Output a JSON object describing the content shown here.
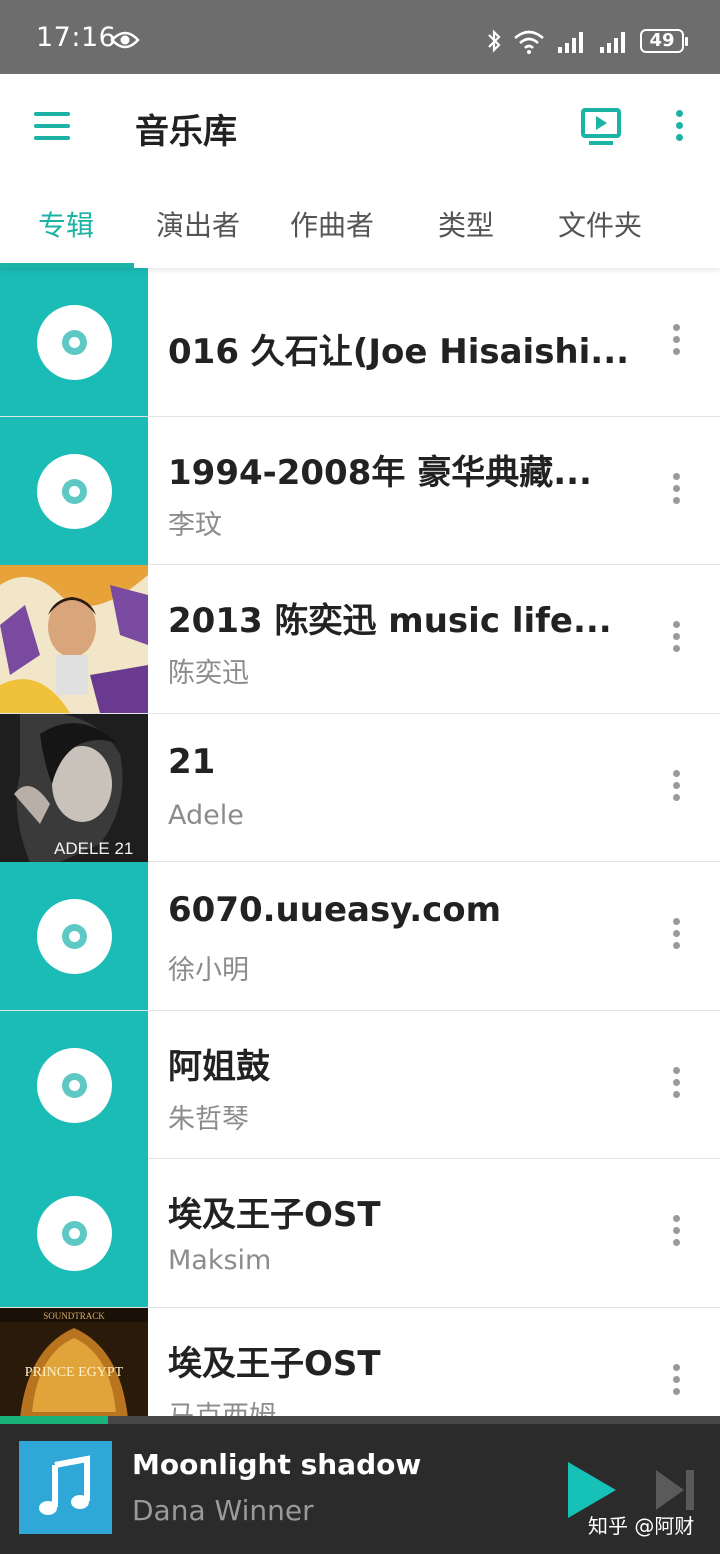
{
  "status_bar": {
    "time": "17:16",
    "battery": "49"
  },
  "app_bar": {
    "title": "音乐库"
  },
  "tabs": [
    {
      "label": "专辑",
      "active": true
    },
    {
      "label": "演出者",
      "active": false
    },
    {
      "label": "作曲者",
      "active": false
    },
    {
      "label": "类型",
      "active": false
    },
    {
      "label": "文件夹",
      "active": false
    }
  ],
  "albums": [
    {
      "title": "016 久石让(Joe Hisaishi...",
      "artist": "",
      "cover": "disc-icon"
    },
    {
      "title": "1994-2008年 豪华典藏...",
      "artist": "李玟",
      "cover": "disc-icon"
    },
    {
      "title": "2013 陈奕迅 music life...",
      "artist": "陈奕迅",
      "cover": "album-art"
    },
    {
      "title": "21",
      "artist": "Adele",
      "cover": "album-art"
    },
    {
      "title": "6070.uueasy.com",
      "artist": "徐小明",
      "cover": "disc-icon"
    },
    {
      "title": "阿姐鼓",
      "artist": "朱哲琴",
      "cover": "disc-icon"
    },
    {
      "title": "埃及王子OST",
      "artist": "Maksim",
      "cover": "disc-icon"
    },
    {
      "title": "埃及王子OST",
      "artist": "马克西姆",
      "cover": "album-art"
    }
  ],
  "album_art_text": {
    "adele": "ADELE 21",
    "egypt_top": "SOUNDTRACK",
    "egypt_name": "PRINCE EGYPT"
  },
  "now_playing": {
    "title": "Moonlight shadow",
    "artist": "Dana Winner",
    "progress": 0.15
  },
  "watermark": "知乎 @阿财",
  "colors": {
    "accent": "#1bb3a4",
    "cover_teal": "#1bbcb6",
    "player_bg": "#2b2b2b",
    "progress": "#1bb37a",
    "play_button": "#16c2b8"
  }
}
